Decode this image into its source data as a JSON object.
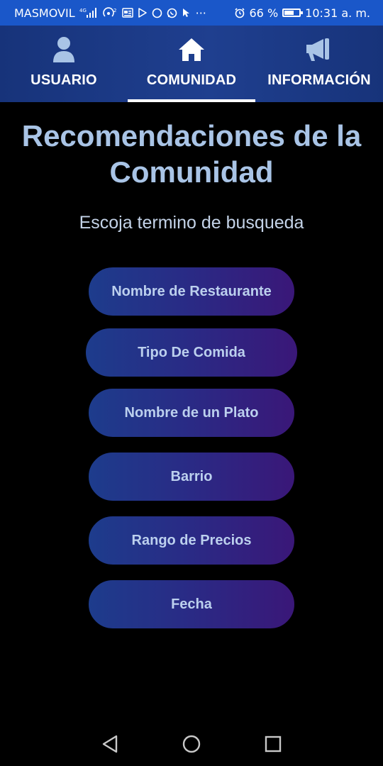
{
  "status_bar": {
    "carrier": "MASMOVIL",
    "network": "4G",
    "notification_icons": [
      "signal-icon",
      "hotspot-icon",
      "news-icon",
      "play-store-icon",
      "circle-app-icon",
      "whatsapp-icon",
      "cursor-app-icon"
    ],
    "more": "···",
    "battery_text": "66 %",
    "battery_level": 0.66,
    "time": "10:31 a. m.",
    "background": "#1a57c9"
  },
  "tabs": [
    {
      "label": "USUARIO",
      "icon": "user-icon",
      "selected": false
    },
    {
      "label": "COMUNIDAD",
      "icon": "home-icon",
      "selected": true
    },
    {
      "label": "INFORMACIÓN",
      "icon": "megaphone-icon",
      "selected": false
    }
  ],
  "main": {
    "title": "Recomendaciones de la Comunidad",
    "subtitle": "Escoja termino de busqueda",
    "options": [
      {
        "label": "Nombre de Restaurante"
      },
      {
        "label": "Tipo De Comida"
      },
      {
        "label": "Nombre de un Plato"
      },
      {
        "label": "Barrio"
      },
      {
        "label": "Rango de Precios"
      },
      {
        "label": "Fecha"
      }
    ]
  },
  "nav_bar": {
    "buttons": [
      "back-icon",
      "home-circle-icon",
      "recents-icon"
    ]
  },
  "colors": {
    "title": "#a9c4e6",
    "tab_bar": "#1f3f8f",
    "button_start": "#1d3c8c",
    "button_end": "#3a1778"
  }
}
